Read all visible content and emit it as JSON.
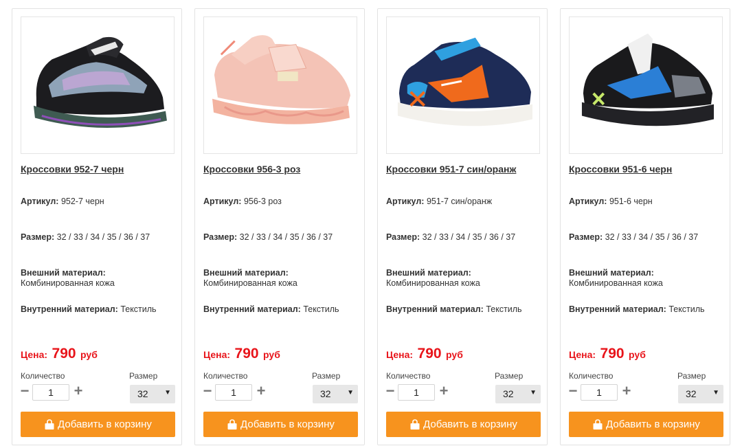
{
  "labels": {
    "article": "Артикул:",
    "size": "Размер:",
    "outer_material": "Внешний материал:",
    "inner_material": "Внутренний материал:",
    "price": "Цена:",
    "currency": "руб",
    "quantity": "Количество",
    "size_select": "Размер",
    "add_to_cart": "Добавить в корзину",
    "minus": "−",
    "plus": "+"
  },
  "colors": {
    "price": "#e8141a",
    "button": "#f7931e"
  },
  "icons": {
    "cart": "shopping-bag-icon",
    "select": "chevron-down-icon"
  },
  "products": [
    {
      "title": "Кроссовки 952-7 черн",
      "article": "952-7 черн",
      "sizes": "32 / 33 / 34 / 35 / 36 / 37",
      "outer_material": "Комбинированная кожа",
      "inner_material": "Текстиль",
      "price": "790",
      "quantity": "1",
      "selected_size": "32"
    },
    {
      "title": "Кроссовки 956-3 роз",
      "article": "956-3 роз",
      "sizes": "32 / 33 / 34 / 35 / 36 / 37",
      "outer_material": "Комбинированная кожа",
      "inner_material": "Текстиль",
      "price": "790",
      "quantity": "1",
      "selected_size": "32"
    },
    {
      "title": "Кроссовки 951-7 син/оранж",
      "article": "951-7 син/оранж",
      "sizes": "32 / 33 / 34 / 35 / 36 / 37",
      "outer_material": "Комбинированная кожа",
      "inner_material": "Текстиль",
      "price": "790",
      "quantity": "1",
      "selected_size": "32"
    },
    {
      "title": "Кроссовки 951-6 черн",
      "article": "951-6 черн",
      "sizes": "32 / 33 / 34 / 35 / 36 / 37",
      "outer_material": "Комбинированная кожа",
      "inner_material": "Текстиль",
      "price": "790",
      "quantity": "1",
      "selected_size": "32"
    }
  ]
}
